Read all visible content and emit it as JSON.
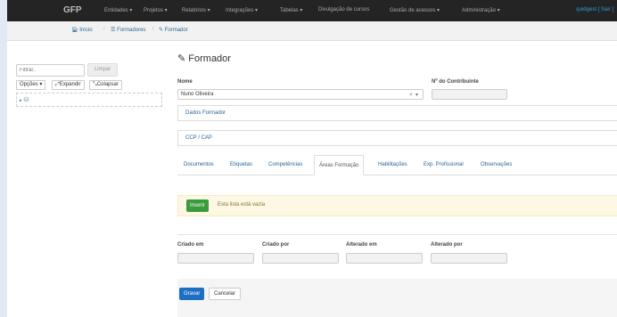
{
  "navbar": {
    "brand": "GFP",
    "items": [
      "Entidades ▾",
      "Projetos ▾",
      "Relatórios ▾",
      "Integrações ▾",
      "Tabelas ▾",
      "Divulgação de cursos",
      "Gestão de acessos ▾",
      "Administração ▾"
    ],
    "user": "quidgest [ Sair ]"
  },
  "breadcrumb": {
    "home": "Início",
    "list": "Formadores",
    "current": "Formador"
  },
  "sidebar": {
    "filter_placeholder": "Filtrar..",
    "clear_label": "Limpar",
    "options_label": "Opções ▾",
    "expand_label": "Expandir",
    "collapse_label": "Colapsar"
  },
  "form": {
    "title": "Formador",
    "name_label": "Nome",
    "name_value": "Nuno Oliveira",
    "nif_label": "Nº do Contribuinte",
    "panels": [
      "Dados Formador",
      "CCP / CAP"
    ],
    "tabs": [
      "Documentos",
      "Etiquetas",
      "Competências",
      "Áreas Formação",
      "Habilitações",
      "Exp. Profissional",
      "Observações"
    ],
    "active_tab": "Áreas Formação",
    "insert_label": "Inserir",
    "empty_text": "Esta lista está vazia",
    "audit": {
      "created_on": "Criado em",
      "created_by": "Criado por",
      "changed_on": "Alterado em",
      "changed_by": "Alterado por"
    },
    "save_label": "Gravar",
    "cancel_label": "Cancelar"
  },
  "colors": {
    "navbar": "#242424",
    "link": "#2a6496",
    "insert": "#3c9a3e",
    "save": "#1c6fc3",
    "alert_bg": "#fcf8e3"
  }
}
